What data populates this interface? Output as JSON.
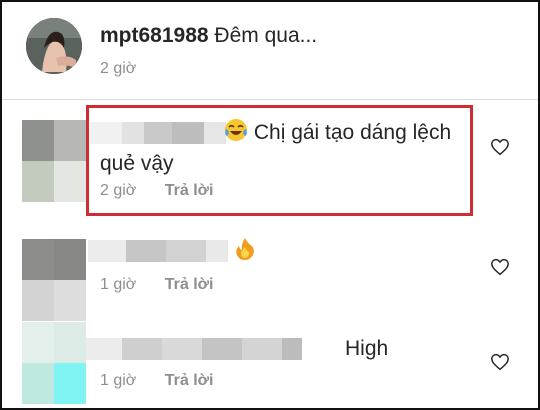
{
  "caption": {
    "username": "mpt681988",
    "text": "Đêm qua...",
    "time": "2 giờ"
  },
  "comments": [
    {
      "text_line1": "Chị gái tạo dáng lệch",
      "text_line2": "quẻ vậy",
      "emoji": "tears-of-joy-emoji",
      "time": "2 giờ",
      "reply": "Trả lời",
      "highlighted": true
    },
    {
      "text": "",
      "emoji": "fire-emoji",
      "time": "1 giờ",
      "reply": "Trả lời"
    },
    {
      "text": "High",
      "emoji": "",
      "time": "1 giờ",
      "reply": "Trả lời"
    }
  ],
  "icons": {
    "like": "heart-outline-icon"
  },
  "colors": {
    "highlight": "#cf2c36",
    "muted": "#8e8e8e",
    "text": "#262626"
  }
}
